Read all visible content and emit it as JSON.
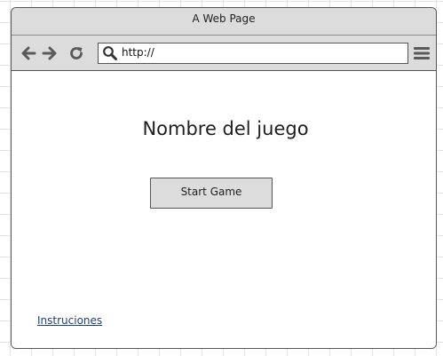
{
  "window": {
    "title": "A Web Page"
  },
  "toolbar": {
    "icons": [
      "arrow-left-icon",
      "arrow-right-icon",
      "refresh-icon",
      "search-icon",
      "hamburger-menu-icon"
    ],
    "address": "http://"
  },
  "main": {
    "game_title": "Nombre del juego",
    "start_button_label": "Start Game",
    "instructions_link": "Instruciones"
  },
  "colors": {
    "chrome": "#dcdcdc",
    "border": "#555555",
    "link": "#1f3f7a"
  }
}
